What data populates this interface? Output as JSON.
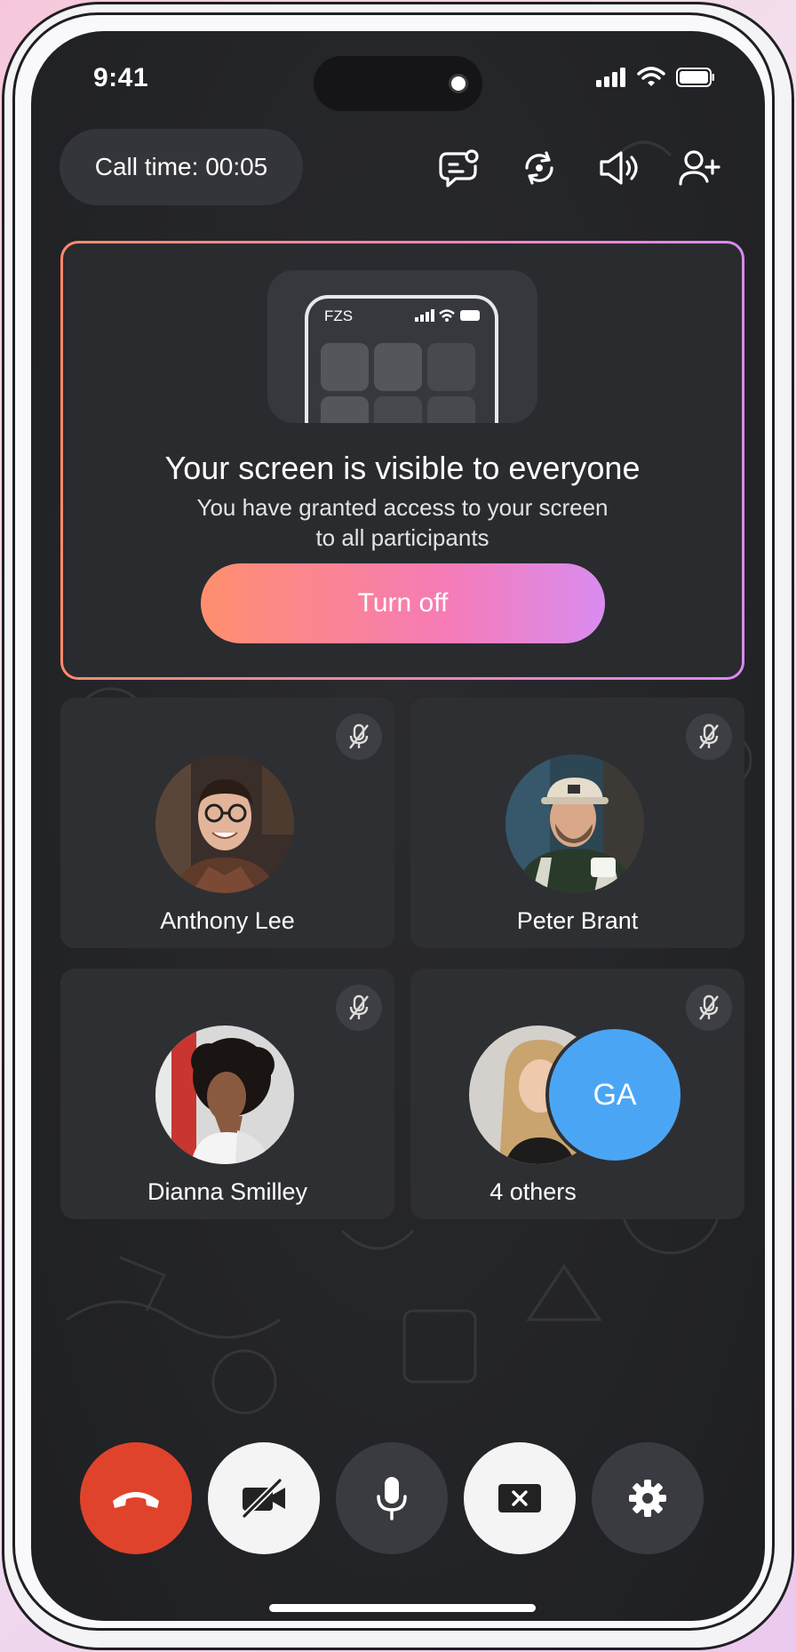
{
  "status_bar": {
    "time": "9:41"
  },
  "header": {
    "call_time": "Call time: 00:05"
  },
  "share_card": {
    "preview_label": "FZS",
    "title": "Your screen is visible to everyone",
    "subtitle": "You have granted access to your screen to all participants",
    "button_label": "Turn off"
  },
  "participants": [
    {
      "name": "Anthony Lee",
      "muted": true
    },
    {
      "name": "Peter Brant",
      "muted": true
    },
    {
      "name": "Dianna Smilley",
      "muted": true
    },
    {
      "name": "4 others",
      "initials": "GA",
      "muted": true
    }
  ],
  "colors": {
    "end_call": "#e0432b",
    "accent_gradient": [
      "#ff8a6b",
      "#f784b4",
      "#d98af0"
    ],
    "initials_avatar": "#4aa6f5"
  },
  "controls": [
    {
      "icon": "end-call-icon"
    },
    {
      "icon": "camera-off-icon"
    },
    {
      "icon": "microphone-icon"
    },
    {
      "icon": "stop-share-icon"
    },
    {
      "icon": "gear-icon"
    }
  ]
}
